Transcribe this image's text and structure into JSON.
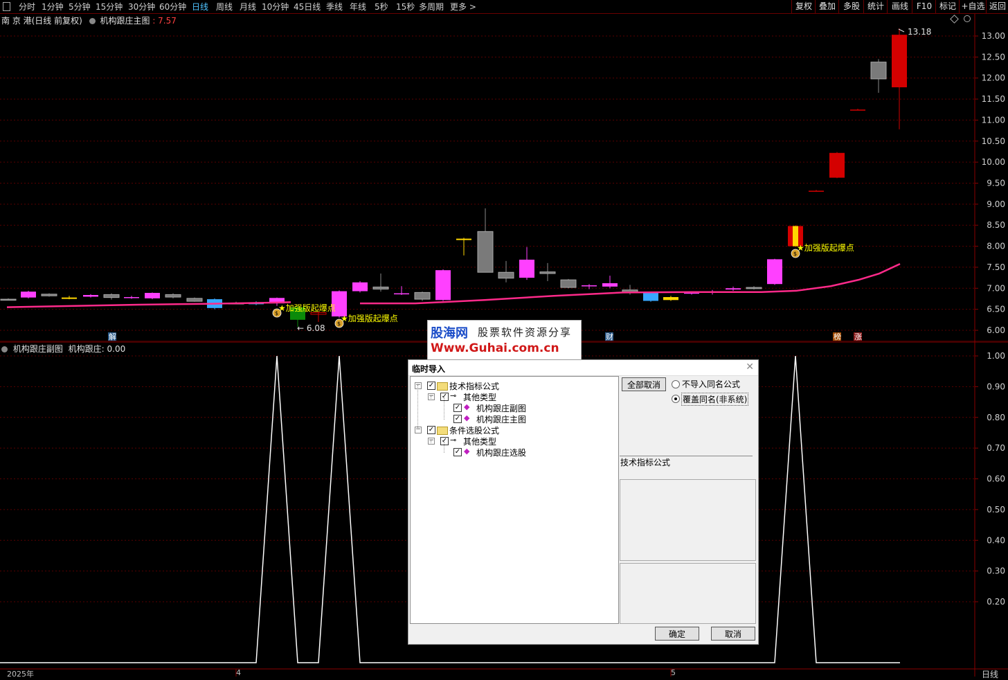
{
  "toolbar": {
    "left_items": [
      "分时",
      "1分钟",
      "5分钟",
      "15分钟",
      "30分钟",
      "60分钟",
      "日线",
      "周线",
      "月线",
      "10分钟",
      "45日线",
      "季线",
      "年线",
      "5秒",
      "15秒",
      "多周期",
      "更多 >"
    ],
    "active": "日线",
    "right_items": [
      "复权",
      "叠加",
      "多股",
      "统计",
      "画线",
      "F10",
      "标记",
      "+自选",
      "返回"
    ]
  },
  "main_chart": {
    "title": "南 京 港(日线 前复权)",
    "indicator_name": "机构跟庄主图",
    "indicator_value": ": 7.57",
    "high_label": "13.18",
    "low_label": "← 6.08",
    "y_ticks": [
      "13.00",
      "12.50",
      "12.00",
      "11.50",
      "11.00",
      "10.50",
      "10.00",
      "9.50",
      "9.00",
      "8.50",
      "8.00",
      "7.50",
      "7.00",
      "6.50",
      "6.00"
    ],
    "signals": [
      "★加强版起爆点",
      "★加强版起爆点",
      "★加强版起爆点"
    ],
    "markers": [
      "解",
      "财",
      "榜",
      "涨"
    ]
  },
  "sub_chart": {
    "title": "机构跟庄副图",
    "value_label": "机构跟庄: 0.00",
    "y_ticks": [
      "1.00",
      "0.90",
      "0.80",
      "0.70",
      "0.60",
      "0.50",
      "0.40",
      "0.30",
      "0.20"
    ]
  },
  "x_axis": {
    "labels": [
      "2025年",
      "4",
      "5"
    ],
    "period_label": "日线"
  },
  "watermark": {
    "line1_a": "股海网",
    "line1_b": "股票软件资源分享",
    "line2": "Www.Guhai.com.cn"
  },
  "dialog": {
    "title": "临时导入",
    "tree": [
      {
        "label": "技术指标公式",
        "level": 0
      },
      {
        "label": "其他类型",
        "level": 1
      },
      {
        "label": "机构跟庄副图",
        "level": 2
      },
      {
        "label": "机构跟庄主图",
        "level": 2
      },
      {
        "label": "条件选股公式",
        "level": 0
      },
      {
        "label": "其他类型",
        "level": 1
      },
      {
        "label": "机构跟庄选股",
        "level": 2
      }
    ],
    "cancel_all": "全部取消",
    "radio_no_import": "不导入同名公式",
    "radio_overwrite": "覆盖同名(非系统)",
    "section_label": "技术指标公式",
    "ok": "确定",
    "cancel": "取消"
  },
  "colors": {
    "up_candle": "#ff40ff",
    "down_candle": "#8a8a8a",
    "ma_line": "#ff2a8a",
    "active_period": "#4fc3ff",
    "grid": "#6a0000"
  }
}
